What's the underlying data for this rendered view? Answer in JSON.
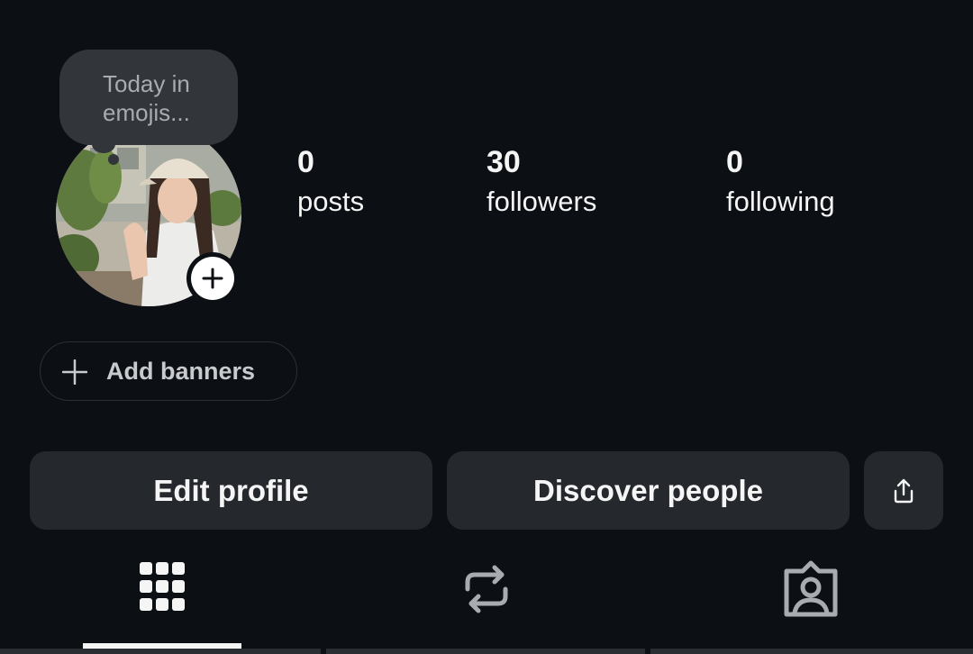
{
  "note": {
    "text": "Today in emojis..."
  },
  "profile": {
    "avatar_alt": "profile photo",
    "add_story_icon": "plus-icon"
  },
  "stats": [
    {
      "value": "0",
      "label": "posts"
    },
    {
      "value": "30",
      "label": "followers"
    },
    {
      "value": "0",
      "label": "following"
    }
  ],
  "banners": {
    "label": "Add banners",
    "icon": "plus-icon"
  },
  "actions": {
    "edit_profile": "Edit profile",
    "discover_people": "Discover people",
    "share_icon": "share-icon"
  },
  "tabs": [
    {
      "name": "posts-grid",
      "icon": "grid-icon",
      "active": true
    },
    {
      "name": "reposts",
      "icon": "repost-icon",
      "active": false
    },
    {
      "name": "tagged",
      "icon": "tagged-person-icon",
      "active": false
    }
  ],
  "colors": {
    "background": "#0c1014",
    "button_bg": "#25292e",
    "note_bg": "#32353a",
    "text_primary": "#f5f5f5",
    "icon_muted": "#a8abb0"
  }
}
